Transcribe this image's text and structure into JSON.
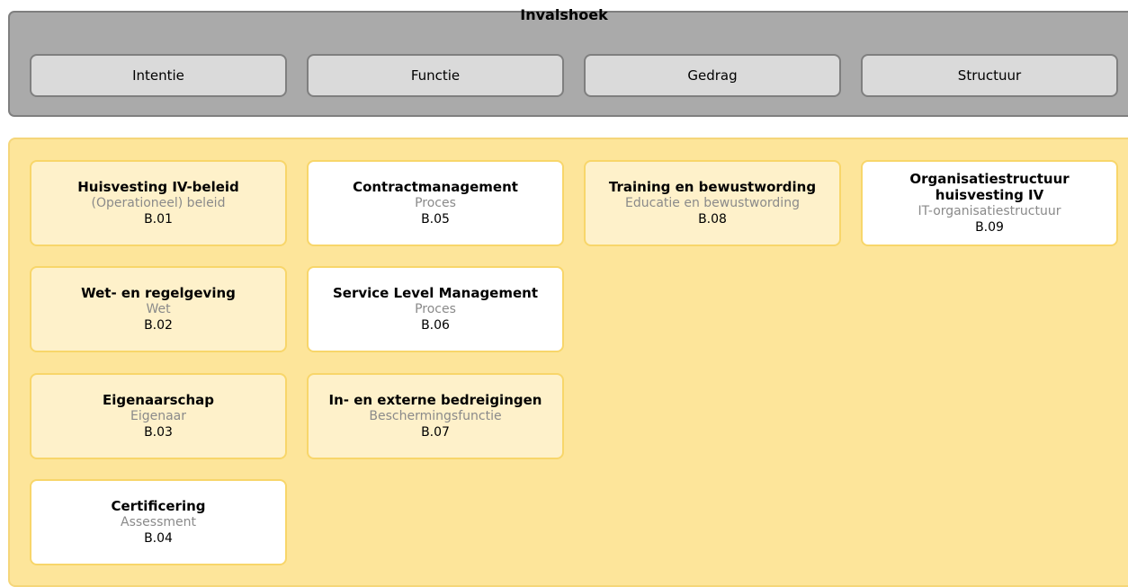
{
  "header": {
    "title": "Invalshoek",
    "views": [
      "Intentie",
      "Functie",
      "Gedrag",
      "Structuur"
    ]
  },
  "cards": [
    {
      "title": "Huisvesting IV-beleid",
      "subtitle": "(Operationeel) beleid",
      "code": "B.01",
      "style": "light"
    },
    {
      "title": "Wet- en regelgeving",
      "subtitle": "Wet",
      "code": "B.02",
      "style": "light"
    },
    {
      "title": "Eigenaarschap",
      "subtitle": "Eigenaar",
      "code": "B.03",
      "style": "light"
    },
    {
      "title": "Certificering",
      "subtitle": "Assessment",
      "code": "B.04",
      "style": "white"
    },
    {
      "title": "Contractmanagement",
      "subtitle": "Proces",
      "code": "B.05",
      "style": "white"
    },
    {
      "title": "Service Level Management",
      "subtitle": "Proces",
      "code": "B.06",
      "style": "white"
    },
    {
      "title": "In- en externe bedreigingen",
      "subtitle": "Beschermingsfunctie",
      "code": "B.07",
      "style": "light"
    },
    {
      "title": "Training en bewustwording",
      "subtitle": "Educatie en bewustwording",
      "code": "B.08",
      "style": "light"
    },
    {
      "title": "Organisatiestructuur huisvesting IV",
      "subtitle": "IT-organisatiestructuur",
      "code": "B.09",
      "style": "white"
    }
  ],
  "colors": {
    "header_bg": "#aaaaaa",
    "button_bg": "#dadada",
    "panel_bg": "#fde59a",
    "card_light": "#fef1ca",
    "card_white": "#ffffff",
    "subtitle_text": "#8a8a8a"
  }
}
